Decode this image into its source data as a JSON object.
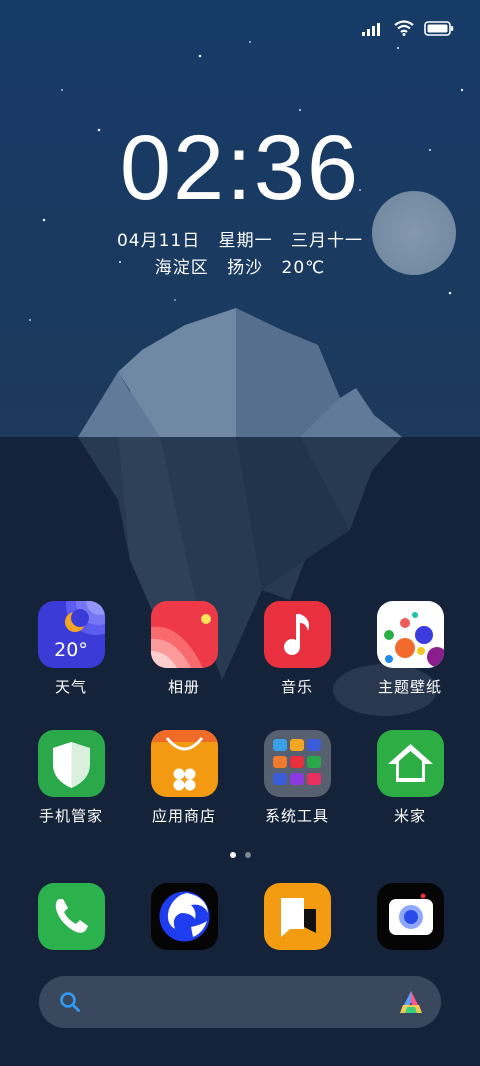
{
  "status": {
    "icons": [
      "signal-icon",
      "wifi-icon",
      "battery-icon"
    ]
  },
  "lockscreen": {
    "time": "02:36",
    "date": "04月11日",
    "weekday": "星期一",
    "lunar_date": "三月十一",
    "location_district": "海淀区",
    "weather": "扬沙",
    "temperature": "20℃"
  },
  "home": {
    "row1": [
      {
        "label": "天气",
        "icon": "weather-icon",
        "badge": "20°"
      },
      {
        "label": "相册",
        "icon": "gallery-icon"
      },
      {
        "label": "音乐",
        "icon": "music-icon"
      },
      {
        "label": "主题壁纸",
        "icon": "themes-icon"
      }
    ],
    "row2": [
      {
        "label": "手机管家",
        "icon": "security-icon"
      },
      {
        "label": "应用商店",
        "icon": "app-store-icon"
      },
      {
        "label": "系统工具",
        "icon": "folder-icon"
      },
      {
        "label": "米家",
        "icon": "mi-home-icon"
      }
    ],
    "page_indicator": {
      "pages": 2,
      "current": 1
    },
    "dock": [
      {
        "icon": "phone-icon"
      },
      {
        "icon": "browser-icon"
      },
      {
        "icon": "messages-icon"
      },
      {
        "icon": "camera-icon"
      }
    ],
    "search": {
      "icon": "search-icon",
      "assistant_icon": "ai-assistant-icon"
    }
  },
  "colors": {
    "sky_top": "#173d6a",
    "sky_bottom": "#1c3759",
    "water": "#14233a",
    "weather_bg": "#3b3bd8",
    "gallery_bg": "#ee3a48",
    "music_bg": "#e8303e",
    "security_bg": "#2aa84a",
    "store_bg": "#f39a12",
    "folder_bg": "#56606e",
    "mihome_bg": "#2cae45",
    "phone_bg": "#2bb24c",
    "messages_bg": "#f39c12"
  }
}
